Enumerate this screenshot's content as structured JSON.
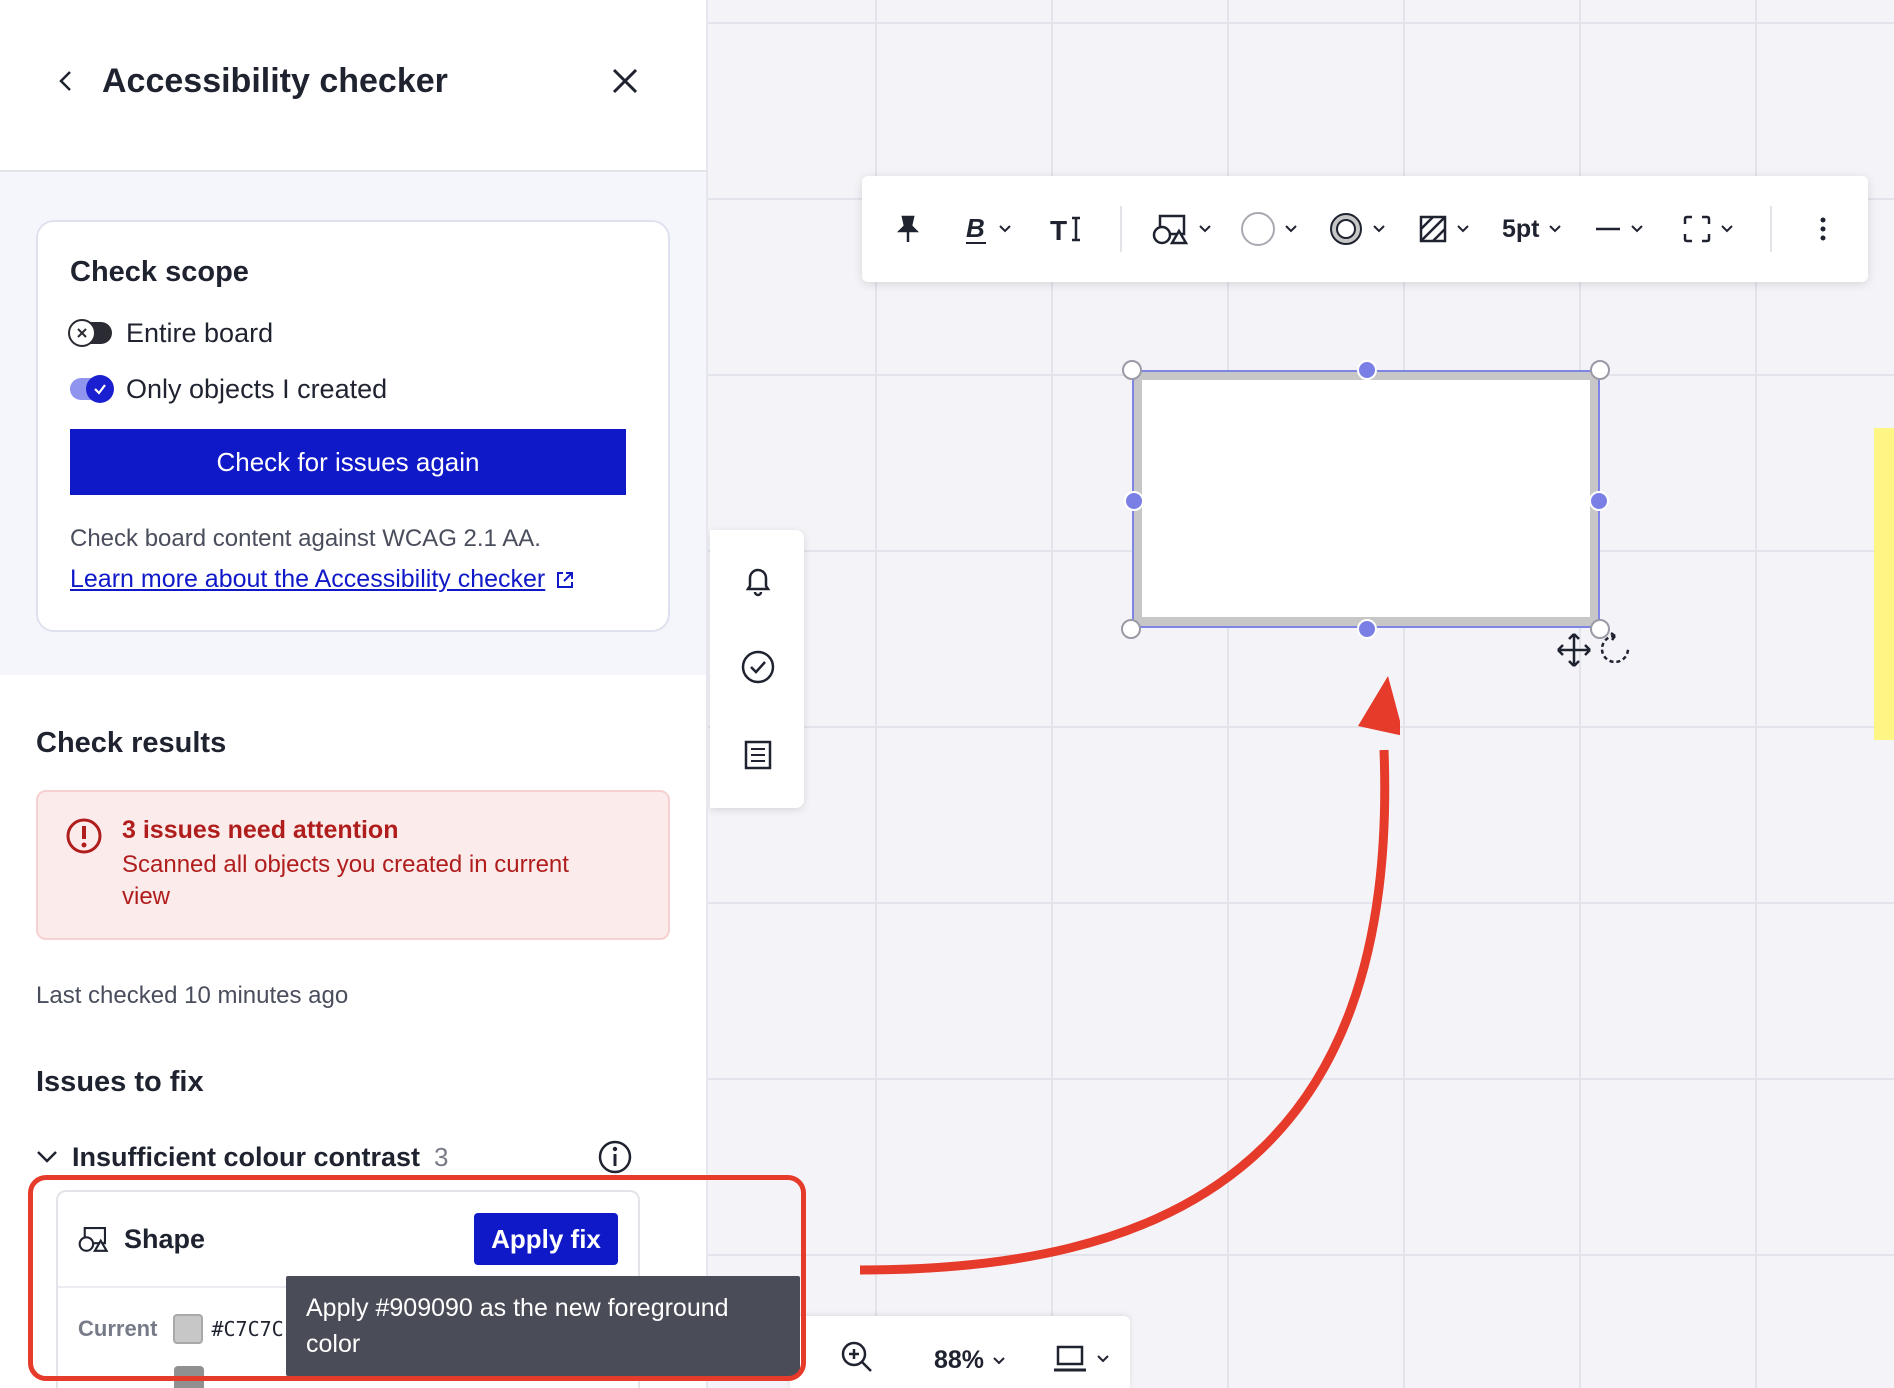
{
  "sidebar": {
    "title": "Accessibility checker",
    "scope": {
      "title": "Check scope",
      "options": [
        {
          "label": "Entire board",
          "enabled": false
        },
        {
          "label": "Only objects I created",
          "enabled": true
        }
      ],
      "button": "Check for issues again",
      "description": "Check board content against WCAG 2.1 AA.",
      "link": "Learn more about the Accessibility checker"
    },
    "results": {
      "title": "Check results",
      "alert_title": "3 issues need attention",
      "alert_body": "Scanned all objects you created in current view",
      "last_checked": "Last checked 10 minutes ago"
    },
    "issues": {
      "title": "Issues to fix",
      "category": "Insufficient colour contrast",
      "count": "3",
      "item": {
        "name": "Shape",
        "apply_label": "Apply fix",
        "current_label": "Current",
        "current_hex": "#C7C7C",
        "current_color": "#C7C7C7",
        "suggested_color": "#909090"
      }
    },
    "tooltip": "Apply #909090 as the new foreground color"
  },
  "toolbar": {
    "stroke_width": "5pt",
    "items": [
      "pin-icon",
      "bold-icon",
      "text-style-icon",
      "shape-icon",
      "fill-color-icon",
      "border-color-icon",
      "border-style-icon",
      "stroke-width",
      "line-style-icon",
      "shape-frame-icon",
      "more-icon"
    ]
  },
  "rail": [
    "bell-icon",
    "check-circle-icon",
    "list-icon"
  ],
  "zoom": {
    "level": "88%"
  },
  "colors": {
    "accent": "#1019C8",
    "alert": "#B01D1D",
    "annotation": "#E63A2B",
    "sticky": "#FDF584"
  }
}
